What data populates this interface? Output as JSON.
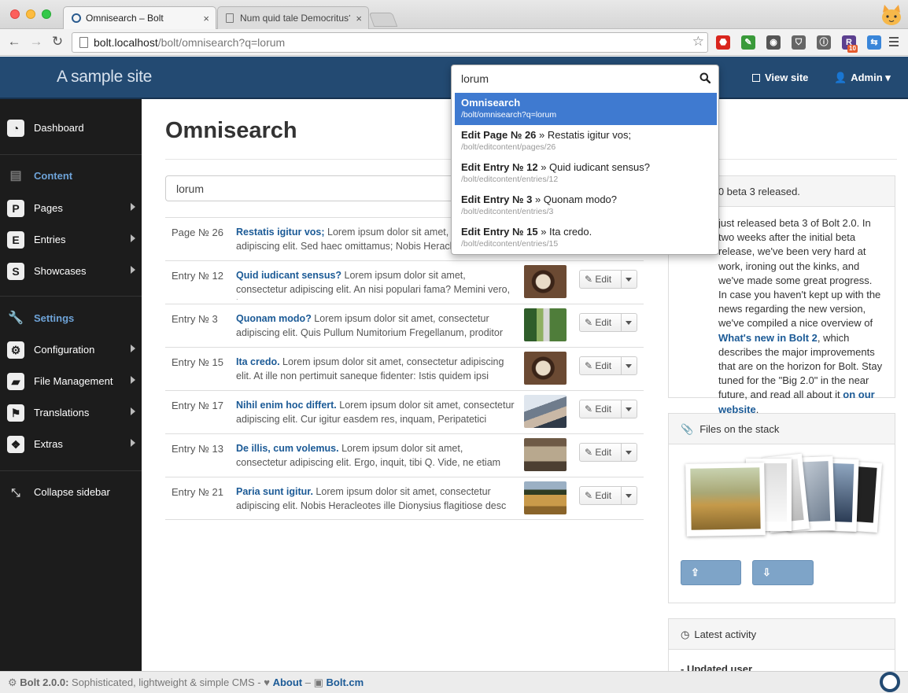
{
  "browser": {
    "tabs": [
      {
        "title": "Omnisearch – Bolt",
        "active": true
      },
      {
        "title": "Num quid tale Democritus?",
        "active": false
      }
    ],
    "close_glyph": "×",
    "url_host": "bolt.localhost",
    "url_path": "/bolt/omnisearch?q=lorum",
    "extensions": [
      {
        "name": "adblock-icon",
        "color": "#d9251d",
        "label": "⬣"
      },
      {
        "name": "evernote-icon",
        "color": "#3a9a3a",
        "label": "✎"
      },
      {
        "name": "elephant-icon",
        "color": "#555555",
        "label": "◉"
      },
      {
        "name": "pocket-icon",
        "color": "#666666",
        "label": "⛉"
      },
      {
        "name": "info-icon",
        "color": "#666666",
        "label": "ⓘ"
      },
      {
        "name": "r-extension-icon",
        "color": "#5b3f8f",
        "label": "R"
      },
      {
        "name": "translate-icon",
        "color": "#3a86d9",
        "label": "⇆"
      }
    ],
    "r_badge": "10"
  },
  "header": {
    "site_title": "A sample site",
    "view_site": "View site",
    "admin": "Admin ▾"
  },
  "sidebar": {
    "items": [
      {
        "label": "Dashboard",
        "icon": "dashboard-icon",
        "glyph": "◔",
        "caret": false,
        "head": false
      },
      {
        "label": "Content",
        "icon": "content-icon",
        "glyph": "▤",
        "caret": false,
        "head": true
      },
      {
        "label": "Pages",
        "icon": "pages-icon",
        "glyph": "P",
        "caret": true,
        "head": false
      },
      {
        "label": "Entries",
        "icon": "entries-icon",
        "glyph": "E",
        "caret": true,
        "head": false
      },
      {
        "label": "Showcases",
        "icon": "showcases-icon",
        "glyph": "S",
        "caret": true,
        "head": false
      },
      {
        "label": "Settings",
        "icon": "wrench-icon",
        "glyph": "🔧",
        "caret": false,
        "head": true
      },
      {
        "label": "Configuration",
        "icon": "cogs-icon",
        "glyph": "⚙",
        "caret": true,
        "head": false
      },
      {
        "label": "File Management",
        "icon": "folder-icon",
        "glyph": "▰",
        "caret": true,
        "head": false
      },
      {
        "label": "Translations",
        "icon": "flag-icon",
        "glyph": "⚑",
        "caret": true,
        "head": false
      },
      {
        "label": "Extras",
        "icon": "cubes-icon",
        "glyph": "❖",
        "caret": true,
        "head": false
      }
    ],
    "collapse": "Collapse sidebar"
  },
  "main": {
    "page_title": "Omnisearch",
    "search_value": "lorum",
    "edit_label": "Edit",
    "results": [
      {
        "type": "Page № 26",
        "title": "Restatis igitur vos;",
        "excerpt": " Lorem ipsum dolor sit amet, consectetur adipiscing elit. Sed haec omittamus; Nobis Heracleotes",
        "thumb": "none"
      },
      {
        "type": "Entry № 12",
        "title": "Quid iudicant sensus?",
        "excerpt": " Lorem ipsum dolor sit amet, consectetur adipiscing elit. An nisi populari fama? Memini vero, inqu",
        "thumb": "coffee"
      },
      {
        "type": "Entry № 3",
        "title": "Quonam modo?",
        "excerpt": " Lorem ipsum dolor sit amet, consectetur adipiscing elit. Quis Pullum Numitorium Fregellanum, proditor",
        "thumb": "switch"
      },
      {
        "type": "Entry № 15",
        "title": "Ita credo.",
        "excerpt": " Lorem ipsum dolor sit amet, consectetur adipiscing elit. At ille non pertimuit saneque fidenter: Istis quidem ipsi",
        "thumb": "coffee"
      },
      {
        "type": "Entry № 17",
        "title": "Nihil enim hoc differt.",
        "excerpt": " Lorem ipsum dolor sit amet, consectetur adipiscing elit. Cur igitur easdem res, inquam, Peripatetici",
        "thumb": "hands"
      },
      {
        "type": "Entry № 13",
        "title": "De illis, cum volemus.",
        "excerpt": " Lorem ipsum dolor sit amet, consectetur adipiscing elit. Ergo, inquit, tibi Q. Vide, ne etiam mense",
        "thumb": "desk"
      },
      {
        "type": "Entry № 21",
        "title": "Paria sunt igitur.",
        "excerpt": " Lorem ipsum dolor sit amet, consectetur adipiscing elit. Nobis Heracleotes ille Dionysius flagitiose desc",
        "thumb": "wheat"
      }
    ]
  },
  "news_panel": {
    "head": "2.0 beta 3 released.",
    "body_start": "just released beta 3 of Bolt 2.0. In two weeks after the initial beta release, we've been very hard at work, ironing out the kinks, and we've made some great progress. In case you haven't kept up with the news regarding the new version, we've compiled a nice overview of ",
    "link1": "What's new in Bolt 2",
    "body_mid": ", which describes the major improvements that are on the horizon for Bolt. Stay tuned for the \"Big 2.0\" in the near future, and read all about it ",
    "link2": "on our website",
    "body_end": "."
  },
  "stack_panel": {
    "head": "Files on the stack",
    "upload": "Upload",
    "select": "Select"
  },
  "activity_panel": {
    "head": "Latest activity",
    "first_item": "- Updated user"
  },
  "footer": {
    "version": "Bolt 2.0.0:",
    "tagline": " Sophisticated, lightweight & simple CMS - ",
    "about": "About",
    "sep": " – ",
    "boltcm": "Bolt.cm"
  },
  "omnisearch": {
    "query": "lorum",
    "items": [
      {
        "strong": "Omnisearch",
        "rest": "",
        "path": "/bolt/omnisearch?q=lorum",
        "selected": true
      },
      {
        "strong": "Edit Page № 26",
        "rest": " » Restatis igitur vos;",
        "path": "/bolt/editcontent/pages/26",
        "selected": false
      },
      {
        "strong": "Edit Entry № 12",
        "rest": " » Quid iudicant sensus?",
        "path": "/bolt/editcontent/entries/12",
        "selected": false
      },
      {
        "strong": "Edit Entry № 3",
        "rest": " » Quonam modo?",
        "path": "/bolt/editcontent/entries/3",
        "selected": false
      },
      {
        "strong": "Edit Entry № 15",
        "rest": " » Ita credo.",
        "path": "/bolt/editcontent/entries/15",
        "selected": false
      }
    ]
  }
}
